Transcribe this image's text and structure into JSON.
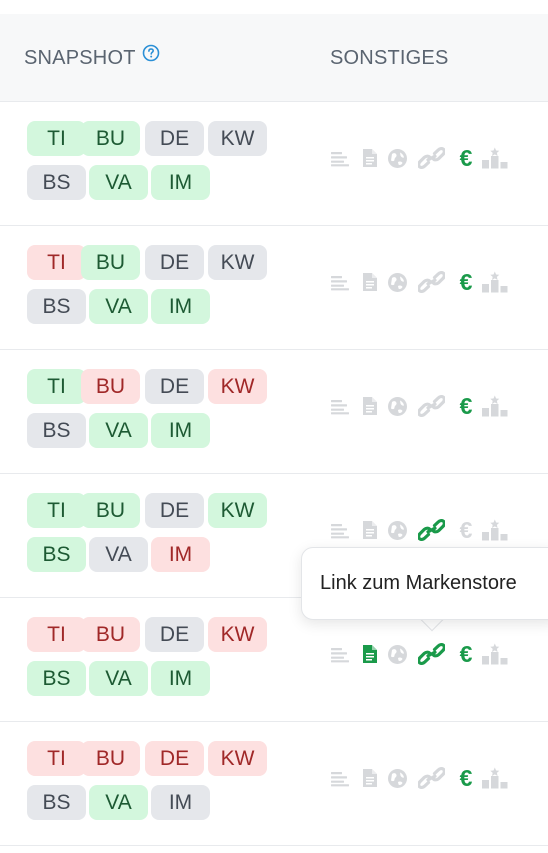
{
  "header": {
    "snapshot_label": "SNAPSHOT",
    "other_label": "SONSTIGES"
  },
  "tooltip": {
    "text": "Link zum Markenstore"
  },
  "colors": {
    "green_bg": "#d3f7dd",
    "red_bg": "#fde0e0",
    "gray_bg": "#e5e7eb",
    "icon_active": "#1a9a4a",
    "icon_inactive": "#d6d8db",
    "help_icon": "#2a8fd6"
  },
  "rows": [
    {
      "tags": [
        {
          "label": "TI",
          "status": "green"
        },
        {
          "label": "BU",
          "status": "green"
        },
        {
          "label": "DE",
          "status": "gray"
        },
        {
          "label": "KW",
          "status": "gray"
        },
        {
          "label": "BS",
          "status": "gray"
        },
        {
          "label": "VA",
          "status": "green"
        },
        {
          "label": "IM",
          "status": "green"
        }
      ],
      "icons": {
        "text": false,
        "document": false,
        "globe": false,
        "link": false,
        "euro": true,
        "ranking": false
      }
    },
    {
      "tags": [
        {
          "label": "TI",
          "status": "red"
        },
        {
          "label": "BU",
          "status": "green"
        },
        {
          "label": "DE",
          "status": "gray"
        },
        {
          "label": "KW",
          "status": "gray"
        },
        {
          "label": "BS",
          "status": "gray"
        },
        {
          "label": "VA",
          "status": "green"
        },
        {
          "label": "IM",
          "status": "green"
        }
      ],
      "icons": {
        "text": false,
        "document": false,
        "globe": false,
        "link": false,
        "euro": true,
        "ranking": false
      }
    },
    {
      "tags": [
        {
          "label": "TI",
          "status": "green"
        },
        {
          "label": "BU",
          "status": "red"
        },
        {
          "label": "DE",
          "status": "gray"
        },
        {
          "label": "KW",
          "status": "red"
        },
        {
          "label": "BS",
          "status": "gray"
        },
        {
          "label": "VA",
          "status": "green"
        },
        {
          "label": "IM",
          "status": "green"
        }
      ],
      "icons": {
        "text": false,
        "document": false,
        "globe": false,
        "link": false,
        "euro": true,
        "ranking": false
      }
    },
    {
      "tags": [
        {
          "label": "TI",
          "status": "green"
        },
        {
          "label": "BU",
          "status": "green"
        },
        {
          "label": "DE",
          "status": "gray"
        },
        {
          "label": "KW",
          "status": "green"
        },
        {
          "label": "BS",
          "status": "green"
        },
        {
          "label": "VA",
          "status": "gray"
        },
        {
          "label": "IM",
          "status": "red"
        }
      ],
      "icons": {
        "text": false,
        "document": false,
        "globe": false,
        "link": true,
        "euro": false,
        "ranking": false
      }
    },
    {
      "tags": [
        {
          "label": "TI",
          "status": "red"
        },
        {
          "label": "BU",
          "status": "red"
        },
        {
          "label": "DE",
          "status": "gray"
        },
        {
          "label": "KW",
          "status": "red"
        },
        {
          "label": "BS",
          "status": "green"
        },
        {
          "label": "VA",
          "status": "green"
        },
        {
          "label": "IM",
          "status": "green"
        }
      ],
      "icons": {
        "text": false,
        "document": true,
        "globe": false,
        "link": true,
        "euro": true,
        "ranking": false
      }
    },
    {
      "tags": [
        {
          "label": "TI",
          "status": "red"
        },
        {
          "label": "BU",
          "status": "red"
        },
        {
          "label": "DE",
          "status": "red"
        },
        {
          "label": "KW",
          "status": "red"
        },
        {
          "label": "BS",
          "status": "gray"
        },
        {
          "label": "VA",
          "status": "green"
        },
        {
          "label": "IM",
          "status": "gray"
        }
      ],
      "icons": {
        "text": false,
        "document": false,
        "globe": false,
        "link": false,
        "euro": true,
        "ranking": false
      }
    }
  ]
}
